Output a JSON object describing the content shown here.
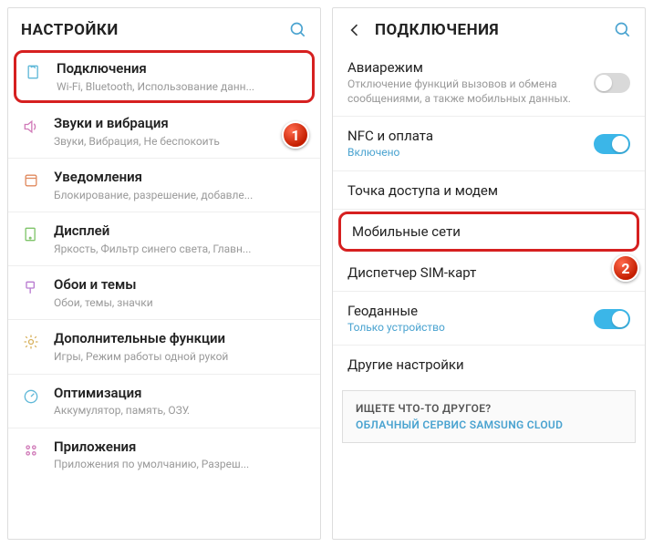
{
  "left": {
    "header": {
      "title": "НАСТРОЙКИ"
    },
    "items": [
      {
        "title": "Подключения",
        "sub": "Wi-Fi, Bluetooth, Использование данн..."
      },
      {
        "title": "Звуки и вибрация",
        "sub": "Звуки, Вибрация, Не беспокоить"
      },
      {
        "title": "Уведомления",
        "sub": "Блокирование, разрешение, добавле..."
      },
      {
        "title": "Дисплей",
        "sub": "Яркость, Фильтр синего света, Главн..."
      },
      {
        "title": "Обои и темы",
        "sub": "Обои, темы, значки"
      },
      {
        "title": "Дополнительные функции",
        "sub": "Игры, Режим работы одной рукой"
      },
      {
        "title": "Оптимизация",
        "sub": "Аккумулятор, память, ОЗУ."
      },
      {
        "title": "Приложения",
        "sub": "Приложения по умолчанию, Разреш..."
      }
    ],
    "badge1": "1"
  },
  "right": {
    "header": {
      "title": "ПОДКЛЮЧЕНИЯ"
    },
    "items": [
      {
        "title": "Авиарежим",
        "sub": "Отключение функций вызовов и обмена сообщениями, а также мобильных данных.",
        "toggle": "off"
      },
      {
        "title": "NFC и оплата",
        "sub": "Включено",
        "sublink": true,
        "toggle": "on"
      },
      {
        "title": "Точка доступа и модем"
      },
      {
        "title": "Мобильные сети"
      },
      {
        "title": "Диспетчер SIM-карт"
      },
      {
        "title": "Геоданные",
        "sub": "Только устройство",
        "sublink": true,
        "toggle": "on"
      },
      {
        "title": "Другие настройки"
      }
    ],
    "footer": {
      "title": "ИЩЕТЕ ЧТО-ТО ДРУГОЕ?",
      "link": "ОБЛАЧНЫЙ СЕРВИС SAMSUNG CLOUD"
    },
    "badge2": "2"
  }
}
